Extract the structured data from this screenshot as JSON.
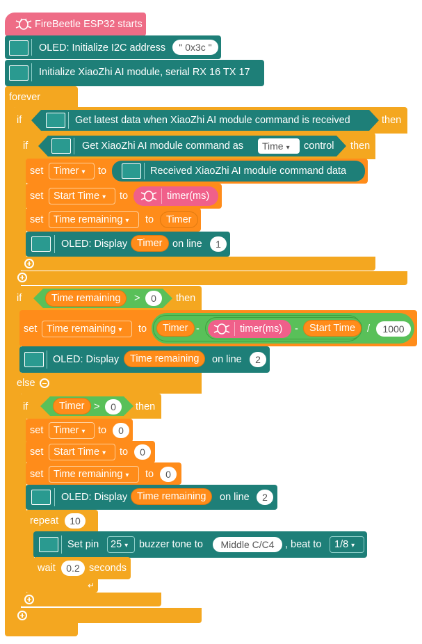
{
  "blocks": {
    "hat": "FireBeetle ESP32 starts",
    "oled_init": "OLED: Initialize I2C address",
    "oled_addr": "\" 0x3c \"",
    "xiaozhi_init": "Initialize XiaoZhi AI module, serial RX 16 TX 17",
    "forever": "forever",
    "if": "if",
    "then": "then",
    "else": "else",
    "set": "set",
    "to": "to",
    "get_latest": "Get latest data when XiaoZhi AI module command is received",
    "get_cmd_as": "Get XiaoZhi AI module command as",
    "time_dd": "Time",
    "control": "control",
    "received_data": "Received XiaoZhi AI module command data",
    "timer_ms": "timer(ms)",
    "oled_display": "OLED: Display",
    "on_line": "on line",
    "gt": ">",
    "minus": "-",
    "divide": "/",
    "repeat": "repeat",
    "set_pin": "Set pin",
    "buzzer": "buzzer tone to",
    "beat_to": ", beat to",
    "wait": "wait",
    "seconds": "seconds"
  },
  "vars": {
    "timer": "Timer",
    "start_time": "Start Time",
    "time_remaining": "Time remaining"
  },
  "values": {
    "line1": "1",
    "line2": "2",
    "zero": "0",
    "k1000": "1000",
    "repeat_n": "10",
    "pin": "25",
    "tone": "Middle C/C4",
    "beat": "1/8",
    "wait_s": "0.2"
  },
  "colors": {
    "hat": "#ee6c86",
    "module": "#1e7f78",
    "control": "#f4a720",
    "variable": "#ff8c1a",
    "operator": "#59c059",
    "timer": "#f0608a"
  }
}
